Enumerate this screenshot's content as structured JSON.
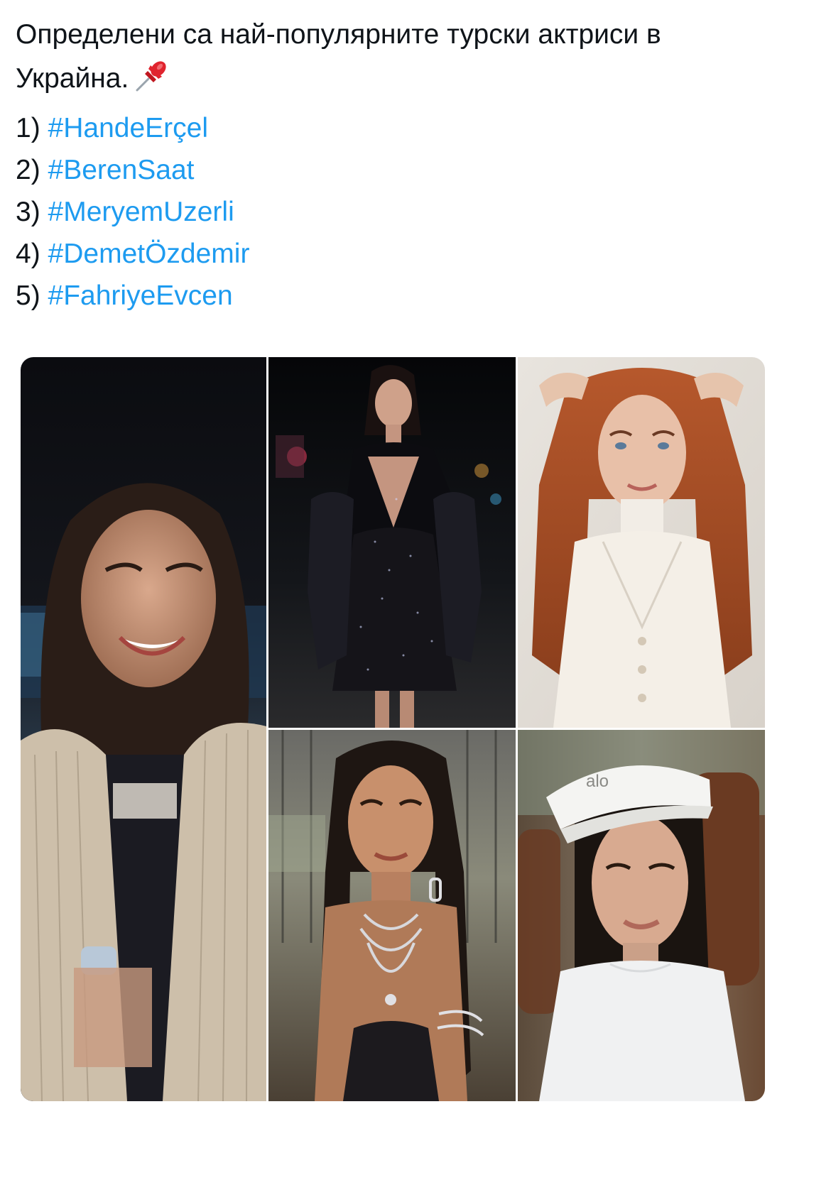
{
  "tweet": {
    "text_line1": "Определени са най-популярните турски актриси в",
    "text_line2": "Украйна.",
    "emoji": "pushpin-icon",
    "list": [
      {
        "number": "1)",
        "hashtag": "#HandeErçel"
      },
      {
        "number": "2)",
        "hashtag": "#BerenSaat"
      },
      {
        "number": "3)",
        "hashtag": "#MeryemUzerli"
      },
      {
        "number": "4)",
        "hashtag": "#DemetÖzdemir"
      },
      {
        "number": "5)",
        "hashtag": "#FahriyeEvcen"
      }
    ]
  },
  "media": {
    "visor_logo": "alo"
  },
  "colors": {
    "text": "#0f1419",
    "link": "#1d9bf0",
    "background": "#ffffff"
  }
}
